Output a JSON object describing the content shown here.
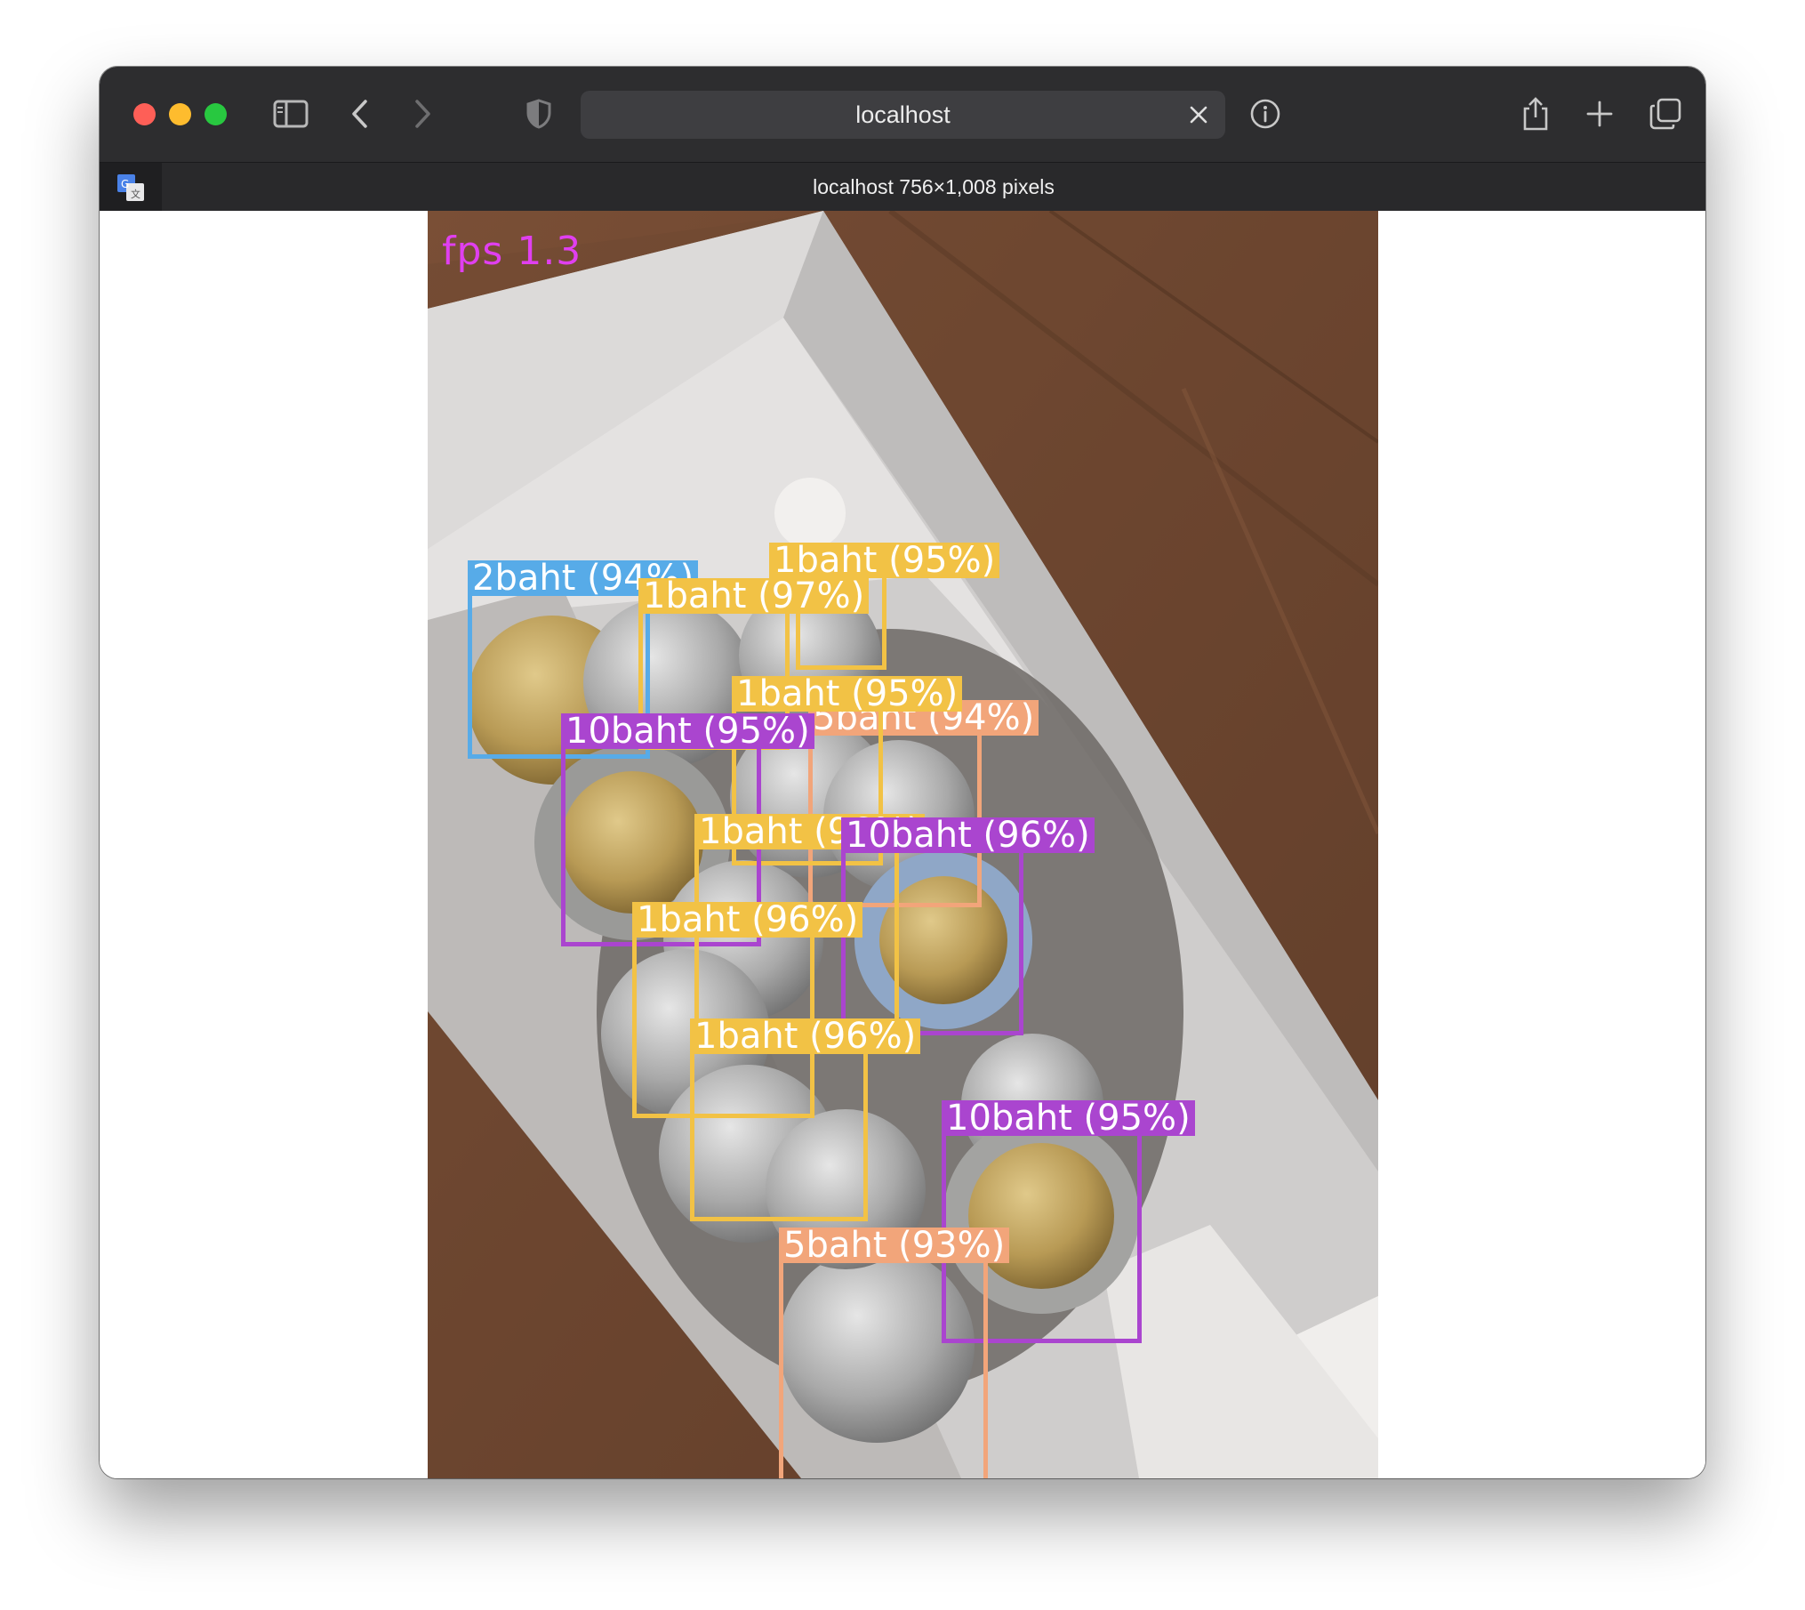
{
  "browser": {
    "url": "localhost",
    "tab_title": "localhost 756×1,008 pixels",
    "toolbar_icons": [
      "sidebar-icon",
      "back-icon",
      "forward-icon",
      "shield-icon",
      "clear-icon",
      "info-icon",
      "share-icon",
      "new-tab-icon",
      "tabs-overview-icon",
      "translate-icon"
    ]
  },
  "viewer": {
    "fps_text": "fps 1.3"
  },
  "detections": [
    {
      "label": "1baht (95%)",
      "color": "#f2c245"
    },
    {
      "label": "2baht (94%)",
      "color": "#57abe8"
    },
    {
      "label": "1baht (97%)",
      "color": "#f2c245"
    },
    {
      "label": "5baht (94%)",
      "color": "#f2a57a"
    },
    {
      "label": "1baht (95%)",
      "color": "#f2c245"
    },
    {
      "label": "10baht (95%)",
      "color": "#aa45cf"
    },
    {
      "label": "1baht (96%)",
      "color": "#f2c245"
    },
    {
      "label": "10baht (96%)",
      "color": "#aa45cf"
    },
    {
      "label": "1baht (96%)",
      "color": "#f2c245"
    },
    {
      "label": "1baht (96%)",
      "color": "#f2c245"
    },
    {
      "label": "10baht (95%)",
      "color": "#aa45cf"
    },
    {
      "label": "5baht (93%)",
      "color": "#f2a57a"
    }
  ]
}
